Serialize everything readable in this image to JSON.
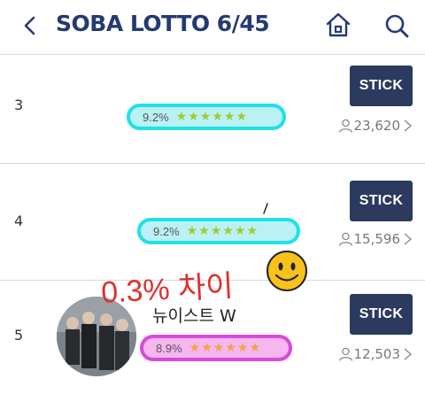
{
  "header": {
    "title": "SOBA LOTTO 6/45"
  },
  "rows": [
    {
      "rank": "3",
      "percent": "9.2%",
      "stick_label": "STICK",
      "count": "23,620"
    },
    {
      "rank": "4",
      "percent": "9.2%",
      "stick_label": "STICK",
      "count": "15,596"
    },
    {
      "rank": "5",
      "percent": "8.9%",
      "stick_label": "STICK",
      "count": "12,503",
      "name": "뉴이스트 W"
    }
  ],
  "annotation": {
    "text": "0.3% 차이"
  },
  "colors": {
    "title": "#233a73",
    "stick_bg": "#2b3a5e",
    "pill_cyan": "#20e0ea",
    "pill_pink": "#d84ad8",
    "annotation": "#e0302e"
  },
  "icons": [
    "back-chevron-icon",
    "home-icon",
    "search-icon",
    "user-icon",
    "chevron-right-icon",
    "smiley-emoji-icon",
    "star-icon"
  ]
}
